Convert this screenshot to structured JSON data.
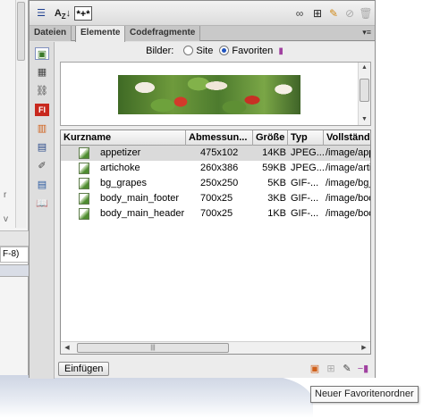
{
  "left_window": {
    "fragment_a": "r",
    "fragment_b": "v",
    "dropdown_text": "F-8)"
  },
  "toolbar": {
    "sort_label": "A",
    "sort_sub": "Z",
    "filter_label": "*+*"
  },
  "tabs": [
    {
      "label": "Dateien"
    },
    {
      "label": "Elemente"
    },
    {
      "label": "Codefragmente"
    }
  ],
  "bilder": {
    "label": "Bilder:",
    "option_site": "Site",
    "option_favoriten": "Favoriten",
    "selected": "Favoriten"
  },
  "table": {
    "headers": [
      "Kurzname",
      "Abmessun...",
      "Größe",
      "Typ",
      "Vollständ"
    ],
    "rows": [
      {
        "name": "appetizer",
        "dims": "475x102",
        "size": "14KB",
        "type": "JPEG...",
        "path": "/image/app"
      },
      {
        "name": "artichoke",
        "dims": "260x386",
        "size": "59KB",
        "type": "JPEG...",
        "path": "/image/artic"
      },
      {
        "name": "bg_grapes",
        "dims": "250x250",
        "size": "5KB",
        "type": "GIF-...",
        "path": "/image/bg_"
      },
      {
        "name": "body_main_footer",
        "dims": "700x25",
        "size": "3KB",
        "type": "GIF-...",
        "path": "/image/bod"
      },
      {
        "name": "body_main_header",
        "dims": "700x25",
        "size": "1KB",
        "type": "GIF-...",
        "path": "/image/bod"
      }
    ],
    "selected_row": 0
  },
  "bottom": {
    "insert_label": "Einfügen"
  },
  "tooltip": {
    "text": "Neuer Favoritenordner"
  },
  "icons": {
    "toolbar": [
      "list-icon",
      "sort-az-icon",
      "filter-icon",
      "link-icon",
      "new-icon",
      "edit-icon",
      "no-icon",
      "trash-icon"
    ],
    "sidebar": [
      "images-icon",
      "colors-icon",
      "urls-icon",
      "flash-icon",
      "shockwave-icon",
      "movies-icon",
      "scripts-icon",
      "templates-icon",
      "library-icon"
    ]
  }
}
